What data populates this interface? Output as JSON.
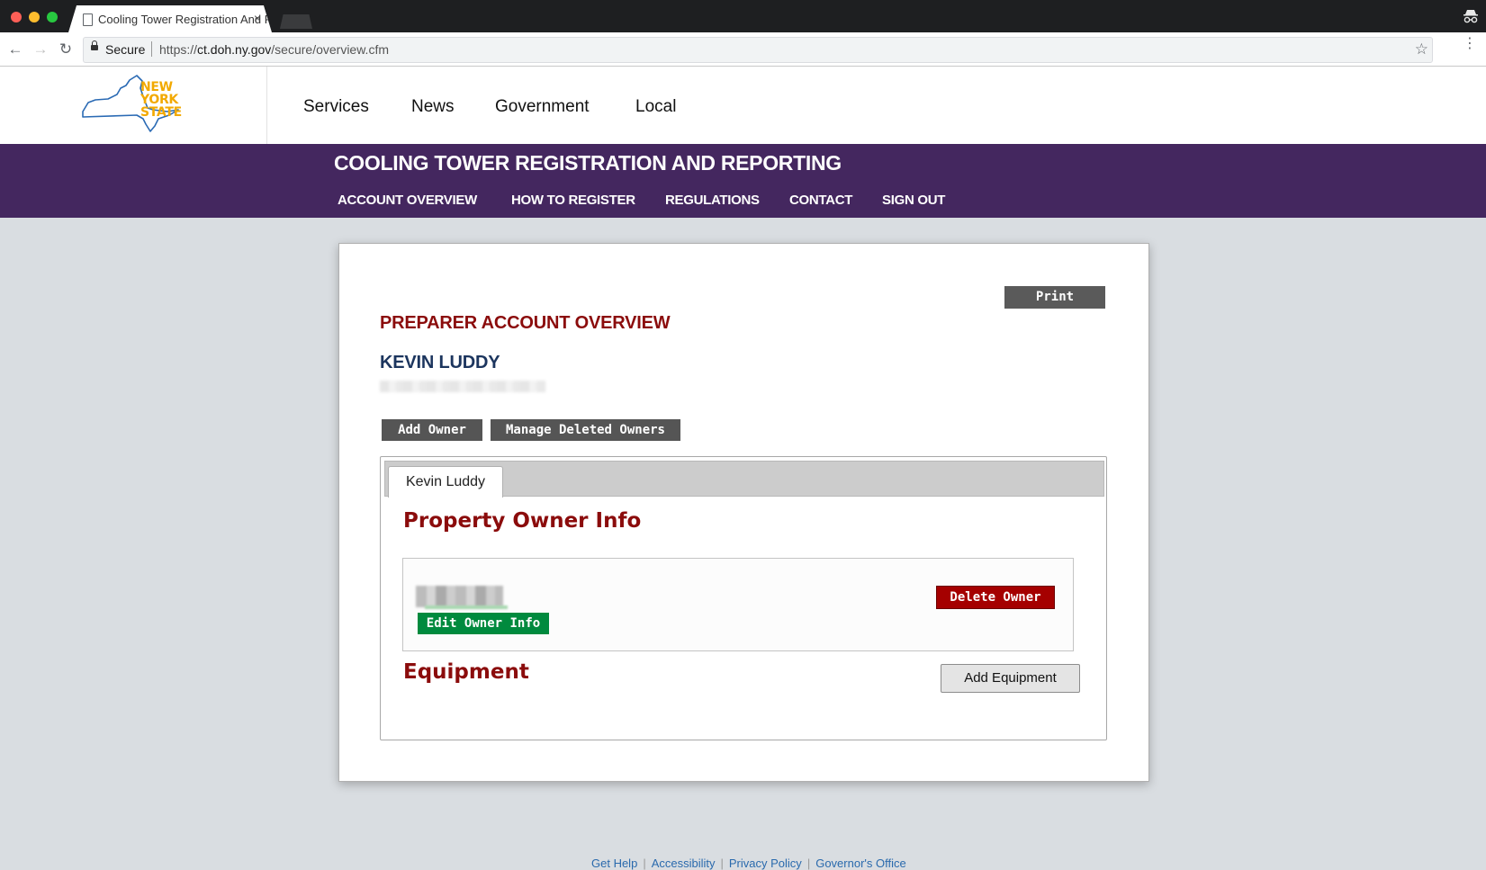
{
  "browser": {
    "tab_title": "Cooling Tower Registration And Reporting",
    "tab_close": "×",
    "secure_label": "Secure",
    "url_scheme": "https://",
    "url_host": "ct.doh.ny.gov",
    "url_path": "/secure/overview.cfm"
  },
  "header": {
    "logo_lines": [
      "NEW",
      "YORK",
      "STATE"
    ],
    "nav": [
      "Services",
      "News",
      "Government",
      "Local"
    ]
  },
  "banner": {
    "title": "COOLING TOWER REGISTRATION AND REPORTING",
    "subnav": [
      "ACCOUNT OVERVIEW",
      "HOW TO REGISTER",
      "REGULATIONS",
      "CONTACT",
      "SIGN OUT"
    ]
  },
  "card": {
    "print_label": "Print",
    "heading": "PREPARER ACCOUNT OVERVIEW",
    "user_name": "KEVIN LUDDY",
    "add_owner_label": "Add Owner",
    "manage_deleted_label": "Manage Deleted Owners",
    "owner_tab": "Kevin Luddy",
    "property_owner_title": "Property Owner Info",
    "edit_owner_label": "Edit Owner Info",
    "delete_owner_label": "Delete Owner",
    "equipment_title": "Equipment",
    "add_equipment_label": "Add Equipment"
  },
  "footer": {
    "links": [
      "Get Help",
      "Accessibility",
      "Privacy Policy",
      "Governor's Office"
    ]
  },
  "colors": {
    "banner_purple": "#44275f",
    "heading_red": "#8b0c0c",
    "name_navy": "#1c355e",
    "edit_green": "#008a3e",
    "delete_red": "#a50000",
    "logo_gold": "#f2a900",
    "logo_blue": "#2a6ab4"
  }
}
